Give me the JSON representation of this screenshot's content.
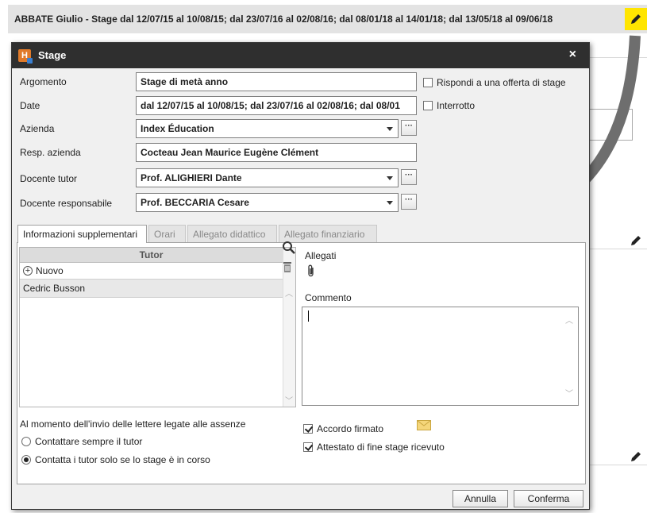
{
  "background": {
    "header_text": "ABBATE Giulio - Stage dal 12/07/15 al 10/08/15; dal 23/07/16 al 02/08/16; dal 08/01/18 al 14/01/18; dal 13/05/18 al 09/06/18",
    "edit_icon": "pencil-icon",
    "accent_color": "#ffe500"
  },
  "dialog": {
    "title": "Stage",
    "close_label": "×",
    "fields": {
      "argomento_label": "Argomento",
      "argomento_value": "Stage di metà anno",
      "date_label": "Date",
      "date_value": "dal 12/07/15 al 10/08/15; dal 23/07/16 al 02/08/16; dal 08/01",
      "azienda_label": "Azienda",
      "azienda_value": "Index Éducation",
      "resp_label": "Resp. azienda",
      "resp_value": "Cocteau Jean Maurice Eugène Clément",
      "tutor_label": "Docente tutor",
      "tutor_value": "Prof. ALIGHIERI Dante",
      "responsabile_label": "Docente responsabile",
      "responsabile_value": "Prof. BECCARIA Cesare",
      "more_label": "···"
    },
    "checkboxes": {
      "offerta_label": "Rispondi a una offerta di stage",
      "offerta_checked": false,
      "interrotto_label": "Interrotto",
      "interrotto_checked": false
    },
    "tabs": [
      {
        "label": "Informazioni supplementari",
        "active": true
      },
      {
        "label": "Orari",
        "active": false
      },
      {
        "label": "Allegato didattico",
        "active": false
      },
      {
        "label": "Allegato finanziario",
        "active": false
      }
    ],
    "tutor_panel": {
      "header": "Tutor",
      "new_label": "Nuovo",
      "rows": [
        "Cedric Busson"
      ]
    },
    "allegati_label": "Allegati",
    "commento_label": "Commento",
    "commento_value": "",
    "assenze_label": "Al momento dell'invio delle lettere legate alle assenze",
    "radio_options": [
      {
        "label": "Contattare sempre il tutor",
        "checked": false
      },
      {
        "label": "Contatta i tutor solo se lo stage è in corso",
        "checked": true
      }
    ],
    "accordo_label": "Accordo firmato",
    "accordo_checked": true,
    "attestato_label": "Attestato di fine stage ricevuto",
    "attestato_checked": true,
    "cancel_label": "Annulla",
    "confirm_label": "Conferma"
  }
}
